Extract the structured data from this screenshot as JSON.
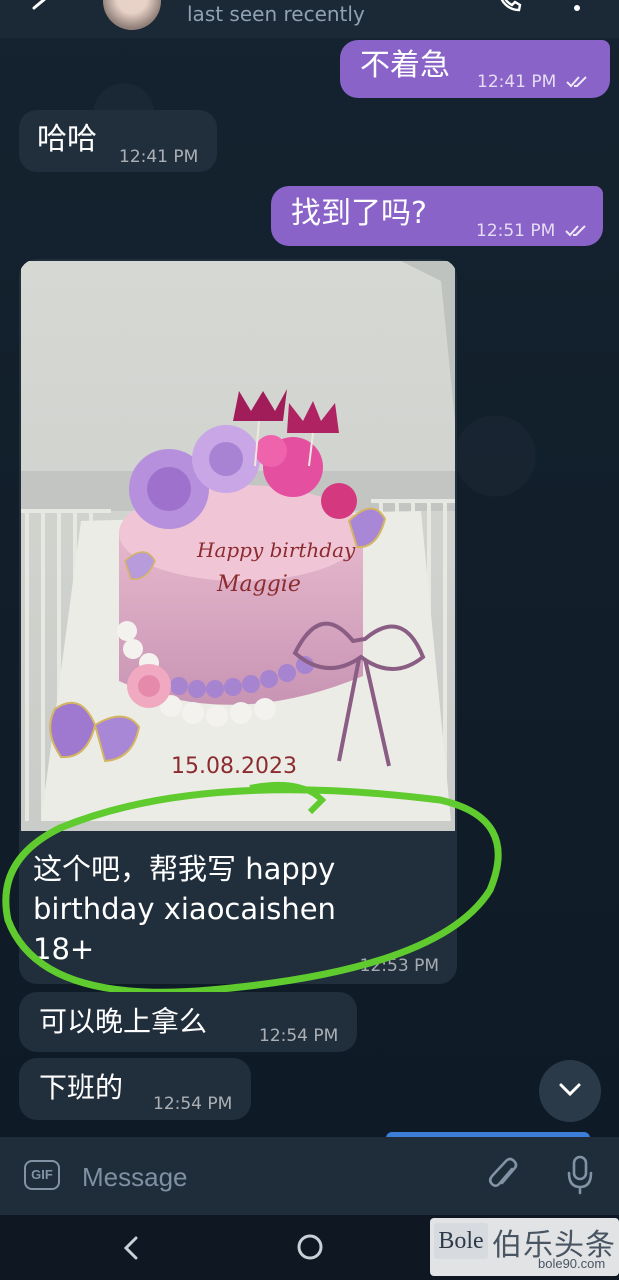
{
  "header": {
    "status": "last seen recently"
  },
  "messages": [
    {
      "direction": "out",
      "text": "不着急",
      "time": "12:41 PM",
      "read": true
    },
    {
      "direction": "in",
      "text": "哈哈",
      "time": "12:41 PM"
    },
    {
      "direction": "out",
      "text": "找到了吗?",
      "time": "12:51 PM",
      "read": true
    },
    {
      "direction": "in",
      "type": "photo",
      "photo_text": {
        "line1": "Happy birthday",
        "line2": "Maggie",
        "date": "15.08.2023"
      },
      "caption": "这个吧，帮我写   happy\nbirthday xiaocaishen\n18+",
      "time": "12:53 PM"
    },
    {
      "direction": "in",
      "text": "可以晚上拿么",
      "time": "12:54 PM"
    },
    {
      "direction": "in",
      "text": "下班的",
      "time": "12:54 PM"
    }
  ],
  "input": {
    "placeholder": "Message",
    "gif_label": "GIF"
  },
  "watermark": {
    "logo": "Bole",
    "name": "伯乐头条",
    "url": "bole90.com"
  },
  "colors": {
    "outgoing_bubble": "#8a63c9",
    "incoming_bubble": "#212f3d",
    "background": "#0f1822",
    "highlight": "#5fcb2f"
  },
  "icons": [
    "back-arrow-icon",
    "phone-icon",
    "more-vert-icon",
    "double-check-icon",
    "chevron-down-icon",
    "gif-icon",
    "paperclip-icon",
    "microphone-icon",
    "nav-back-icon",
    "nav-home-icon"
  ]
}
